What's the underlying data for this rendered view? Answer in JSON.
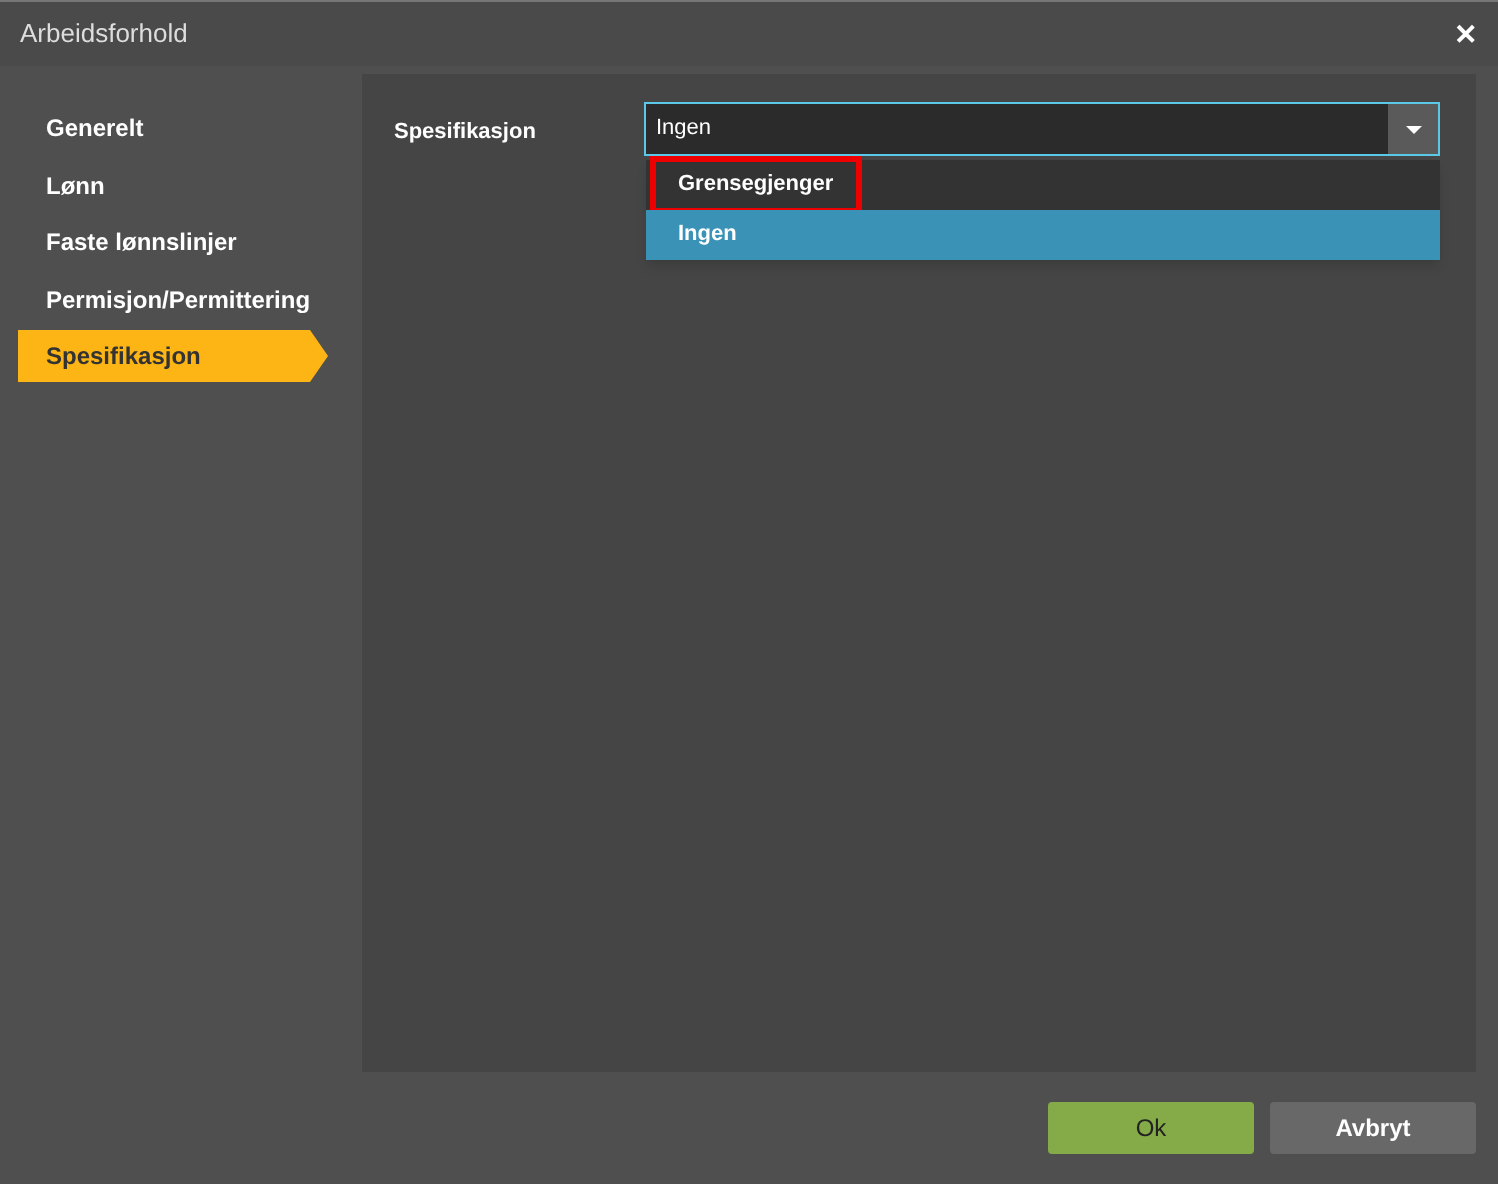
{
  "window": {
    "title": "Arbeidsforhold",
    "close": "✕"
  },
  "sidebar": {
    "items": [
      {
        "label": "Generelt",
        "selected": false
      },
      {
        "label": "Lønn",
        "selected": false
      },
      {
        "label": "Faste lønnslinjer",
        "selected": false
      },
      {
        "label": "Permisjon/Permittering",
        "selected": false
      },
      {
        "label": "Spesifikasjon",
        "selected": true
      }
    ]
  },
  "field": {
    "label": "Spesifikasjon",
    "value": "Ingen",
    "expanded": true,
    "options": [
      {
        "label": "Grensegjenger",
        "selected": false,
        "highlighted": true
      },
      {
        "label": "Ingen",
        "selected": true,
        "highlighted": false
      }
    ]
  },
  "buttons": [
    {
      "label": "Ok",
      "kind": "primary"
    },
    {
      "label": "Avbryt",
      "kind": "secondary"
    }
  ]
}
